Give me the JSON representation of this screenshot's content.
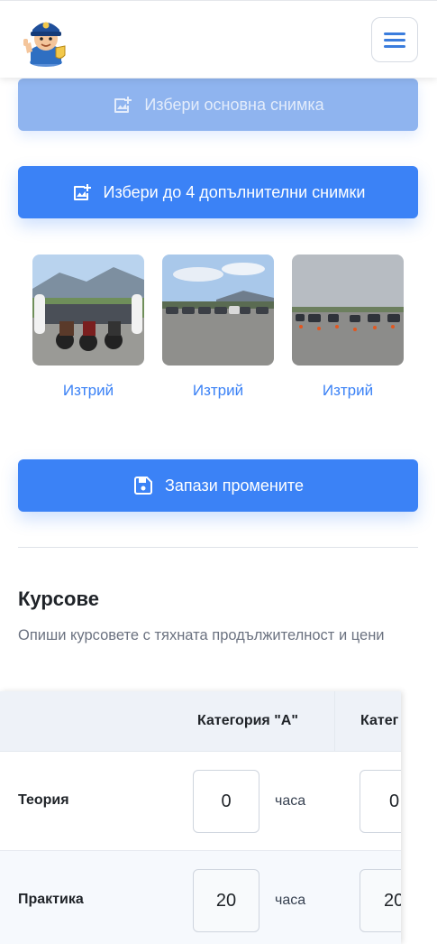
{
  "header": {
    "logo_icon": "police-mascot-logo-icon",
    "menu_icon": "hamburger-menu-icon"
  },
  "buttons": {
    "main_photo": "Избери основна снимка",
    "extra_photos": "Избери до 4 допълнителни снимки",
    "save": "Запази промените"
  },
  "gallery": {
    "images": [
      {
        "alt_icon": "motorcycle-riders-photo",
        "delete_label": "Изтрий"
      },
      {
        "alt_icon": "parking-lot-photo",
        "delete_label": "Изтрий"
      },
      {
        "alt_icon": "training-ground-photo",
        "delete_label": "Изтрий"
      }
    ]
  },
  "courses": {
    "title": "Курсове",
    "description": "Опиши курсовете с тяхната продължителност и цени",
    "columns": [
      "",
      "Категория \"А\"",
      "Катег"
    ],
    "rows": [
      {
        "label": "Теория",
        "cat_a": "0",
        "unit": "часа",
        "cat_b": "0"
      },
      {
        "label": "Практика",
        "cat_a": "20",
        "unit": "часа",
        "cat_b": "20"
      }
    ]
  },
  "colors": {
    "primary": "#3b82f6",
    "primary_disabled": "#8fb4ef",
    "link": "#3b82f6",
    "table_header_bg": "#eef2f8"
  }
}
